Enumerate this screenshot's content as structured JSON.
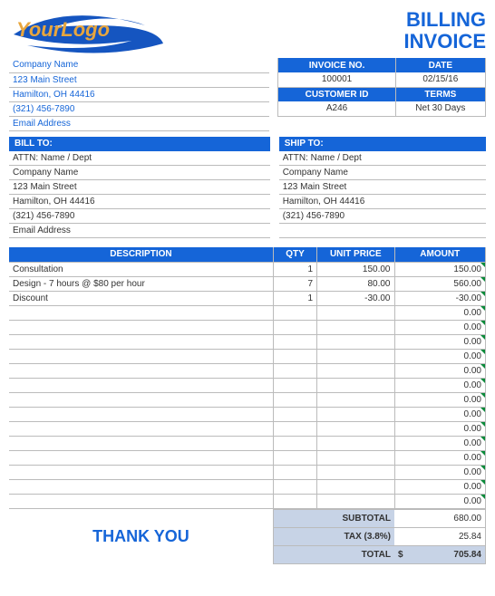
{
  "logo": {
    "text": "YourLogo"
  },
  "title": {
    "line1": "BILLING",
    "line2": "INVOICE"
  },
  "company": {
    "name": "Company Name",
    "street": "123 Main Street",
    "city": "Hamilton, OH  44416",
    "phone": "(321) 456-7890",
    "email": "Email Address"
  },
  "meta": {
    "invoice_no_label": "INVOICE NO.",
    "invoice_no": "100001",
    "date_label": "DATE",
    "date": "02/15/16",
    "customer_id_label": "CUSTOMER ID",
    "customer_id": "A246",
    "terms_label": "TERMS",
    "terms": "Net 30 Days"
  },
  "bill_to": {
    "header": "BILL TO:",
    "attn": "ATTN: Name / Dept",
    "company": "Company Name",
    "street": "123 Main Street",
    "city": "Hamilton, OH  44416",
    "phone": "(321) 456-7890",
    "email": "Email Address"
  },
  "ship_to": {
    "header": "SHIP TO:",
    "attn": "ATTN: Name / Dept",
    "company": "Company Name",
    "street": "123 Main Street",
    "city": "Hamilton, OH  44416",
    "phone": "(321) 456-7890"
  },
  "columns": {
    "desc": "DESCRIPTION",
    "qty": "QTY",
    "price": "UNIT PRICE",
    "amt": "AMOUNT"
  },
  "items": [
    {
      "desc": "Consultation",
      "qty": "1",
      "price": "150.00",
      "amt": "150.00"
    },
    {
      "desc": "Design - 7 hours @ $80 per hour",
      "qty": "7",
      "price": "80.00",
      "amt": "560.00"
    },
    {
      "desc": "Discount",
      "qty": "1",
      "price": "-30.00",
      "amt": "-30.00"
    }
  ],
  "empty_amt": "0.00",
  "totals": {
    "subtotal_label": "SUBTOTAL",
    "subtotal": "680.00",
    "tax_label": "TAX (3.8%)",
    "tax": "25.84",
    "total_label": "TOTAL",
    "total_currency": "$",
    "total": "705.84"
  },
  "thank_you": "THANK YOU"
}
